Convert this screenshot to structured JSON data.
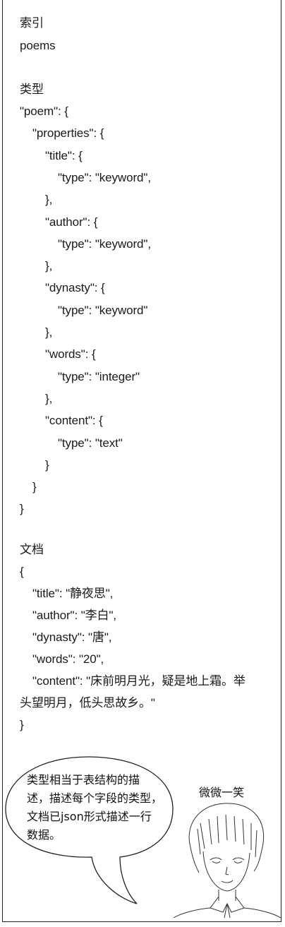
{
  "index": {
    "label": "索引",
    "value": "poems"
  },
  "mapping": {
    "label": "类型",
    "lines": [
      {
        "indent": 0,
        "text": "\"poem\": {"
      },
      {
        "indent": 1,
        "text": "\"properties\": {"
      },
      {
        "indent": 2,
        "text": "\"title\": {"
      },
      {
        "indent": 3,
        "text": "\"type\": \"keyword\","
      },
      {
        "indent": 2,
        "text": "},"
      },
      {
        "indent": 2,
        "text": "\"author\": {"
      },
      {
        "indent": 3,
        "text": "\"type\": \"keyword\","
      },
      {
        "indent": 2,
        "text": "},"
      },
      {
        "indent": 2,
        "text": "\"dynasty\": {"
      },
      {
        "indent": 3,
        "text": "\"type\": \"keyword\""
      },
      {
        "indent": 2,
        "text": "},"
      },
      {
        "indent": 2,
        "text": "\"words\": {"
      },
      {
        "indent": 3,
        "text": "\"type\": \"integer\""
      },
      {
        "indent": 2,
        "text": "},"
      },
      {
        "indent": 2,
        "text": "\"content\": {"
      },
      {
        "indent": 3,
        "text": "\"type\": \"text\""
      },
      {
        "indent": 2,
        "text": "}"
      },
      {
        "indent": 1,
        "text": "}"
      },
      {
        "indent": 0,
        "text": "}"
      }
    ]
  },
  "document": {
    "label": "文档",
    "lines": [
      {
        "indent": 0,
        "text": "{"
      },
      {
        "indent": 1,
        "text": "\"title\": \"静夜思\","
      },
      {
        "indent": 1,
        "text": "\"author\": \"李白\","
      },
      {
        "indent": 1,
        "text": "\"dynasty\": \"唐\","
      },
      {
        "indent": 1,
        "text": "\"words\": \"20\","
      },
      {
        "indent": 1,
        "text": "\"content\": \"床前明月光，疑是地上霜。举"
      },
      {
        "indent": 0,
        "text": "头望明月，低头思故乡。\""
      },
      {
        "indent": 0,
        "text": "}"
      }
    ]
  },
  "bubble": {
    "lines": [
      "类型相当于表结构的描",
      "述，描述每个字段的类型，",
      "文档已json形式描述一行",
      "数据。"
    ]
  },
  "character": {
    "caption": "微微一笑"
  }
}
